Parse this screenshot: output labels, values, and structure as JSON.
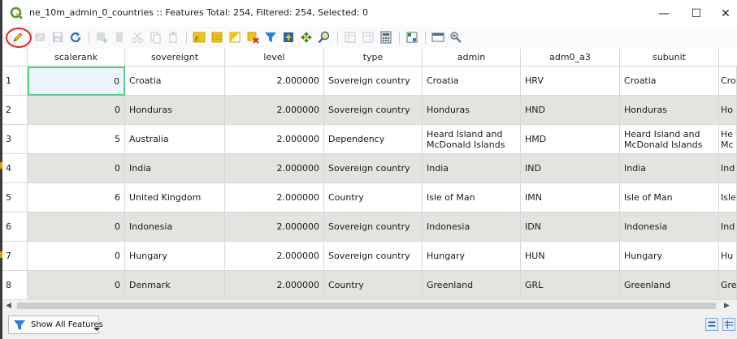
{
  "window": {
    "title": "ne_10m_admin_0_countries :: Features Total: 254, Filtered: 254, Selected: 0",
    "min_glyph": "—",
    "max_glyph": "☐",
    "close_glyph": "✕"
  },
  "toolbar": {
    "icons": [
      "toggle-editing-icon",
      "multi-edit-icon",
      "save-edits-icon",
      "reload-table-icon",
      "add-feature-icon",
      "delete-selected-icon",
      "cut-icon",
      "copy-icon",
      "paste-icon",
      "select-by-expression-icon",
      "select-all-icon",
      "invert-selection-icon",
      "deselect-all-icon",
      "filter-select-icon",
      "move-selection-to-top-icon",
      "pan-to-selection-icon",
      "zoom-to-selection-icon",
      "new-field-icon",
      "delete-field-icon",
      "open-field-calculator-icon",
      "conditional-formatting-icon",
      "dock-table-icon",
      "actions-icon"
    ]
  },
  "table": {
    "columns": [
      "scalerank",
      "sovereignt",
      "level",
      "type",
      "admin",
      "adm0_a3",
      "subunit",
      ""
    ],
    "rows": [
      {
        "n": "1",
        "scalerank": "0",
        "sovereignt": "Croatia",
        "level": "2.000000",
        "type": "Sovereign country",
        "admin": "Croatia",
        "adm0_a3": "HRV",
        "subunit": "Croatia",
        "extra": "Cro"
      },
      {
        "n": "2",
        "scalerank": "0",
        "sovereignt": "Honduras",
        "level": "2.000000",
        "type": "Sovereign country",
        "admin": "Honduras",
        "adm0_a3": "HND",
        "subunit": "Honduras",
        "extra": "Ho"
      },
      {
        "n": "3",
        "scalerank": "5",
        "sovereignt": "Australia",
        "level": "2.000000",
        "type": "Dependency",
        "admin": "Heard Island and McDonald Islands",
        "adm0_a3": "HMD",
        "subunit": "Heard Island and McDonald Islands",
        "extra": "He Mc"
      },
      {
        "n": "4",
        "scalerank": "0",
        "sovereignt": "India",
        "level": "2.000000",
        "type": "Sovereign country",
        "admin": "India",
        "adm0_a3": "IND",
        "subunit": "India",
        "extra": "Ind"
      },
      {
        "n": "5",
        "scalerank": "6",
        "sovereignt": "United Kingdom",
        "level": "2.000000",
        "type": "Country",
        "admin": "Isle of Man",
        "adm0_a3": "IMN",
        "subunit": "Isle of Man",
        "extra": "Isle"
      },
      {
        "n": "6",
        "scalerank": "0",
        "sovereignt": "Indonesia",
        "level": "2.000000",
        "type": "Sovereign country",
        "admin": "Indonesia",
        "adm0_a3": "IDN",
        "subunit": "Indonesia",
        "extra": "Ind"
      },
      {
        "n": "7",
        "scalerank": "0",
        "sovereignt": "Hungary",
        "level": "2.000000",
        "type": "Sovereign country",
        "admin": "Hungary",
        "adm0_a3": "HUN",
        "subunit": "Hungary",
        "extra": "Hu"
      },
      {
        "n": "8",
        "scalerank": "0",
        "sovereignt": "Denmark",
        "level": "2.000000",
        "type": "Country",
        "admin": "Greenland",
        "adm0_a3": "GRL",
        "subunit": "Greenland",
        "extra": "Gre"
      }
    ],
    "selected_cell": "row 1, scalerank"
  },
  "scrollbar": {
    "left_glyph": "◀",
    "right_glyph": "▶"
  },
  "bottom": {
    "show_features_label": "Show All Features"
  },
  "colors": {
    "alt_row": "#e5e3e0",
    "selected_border": "#4fd486",
    "annotation_circle": "#e8211d",
    "qgis_green": "#589632"
  }
}
